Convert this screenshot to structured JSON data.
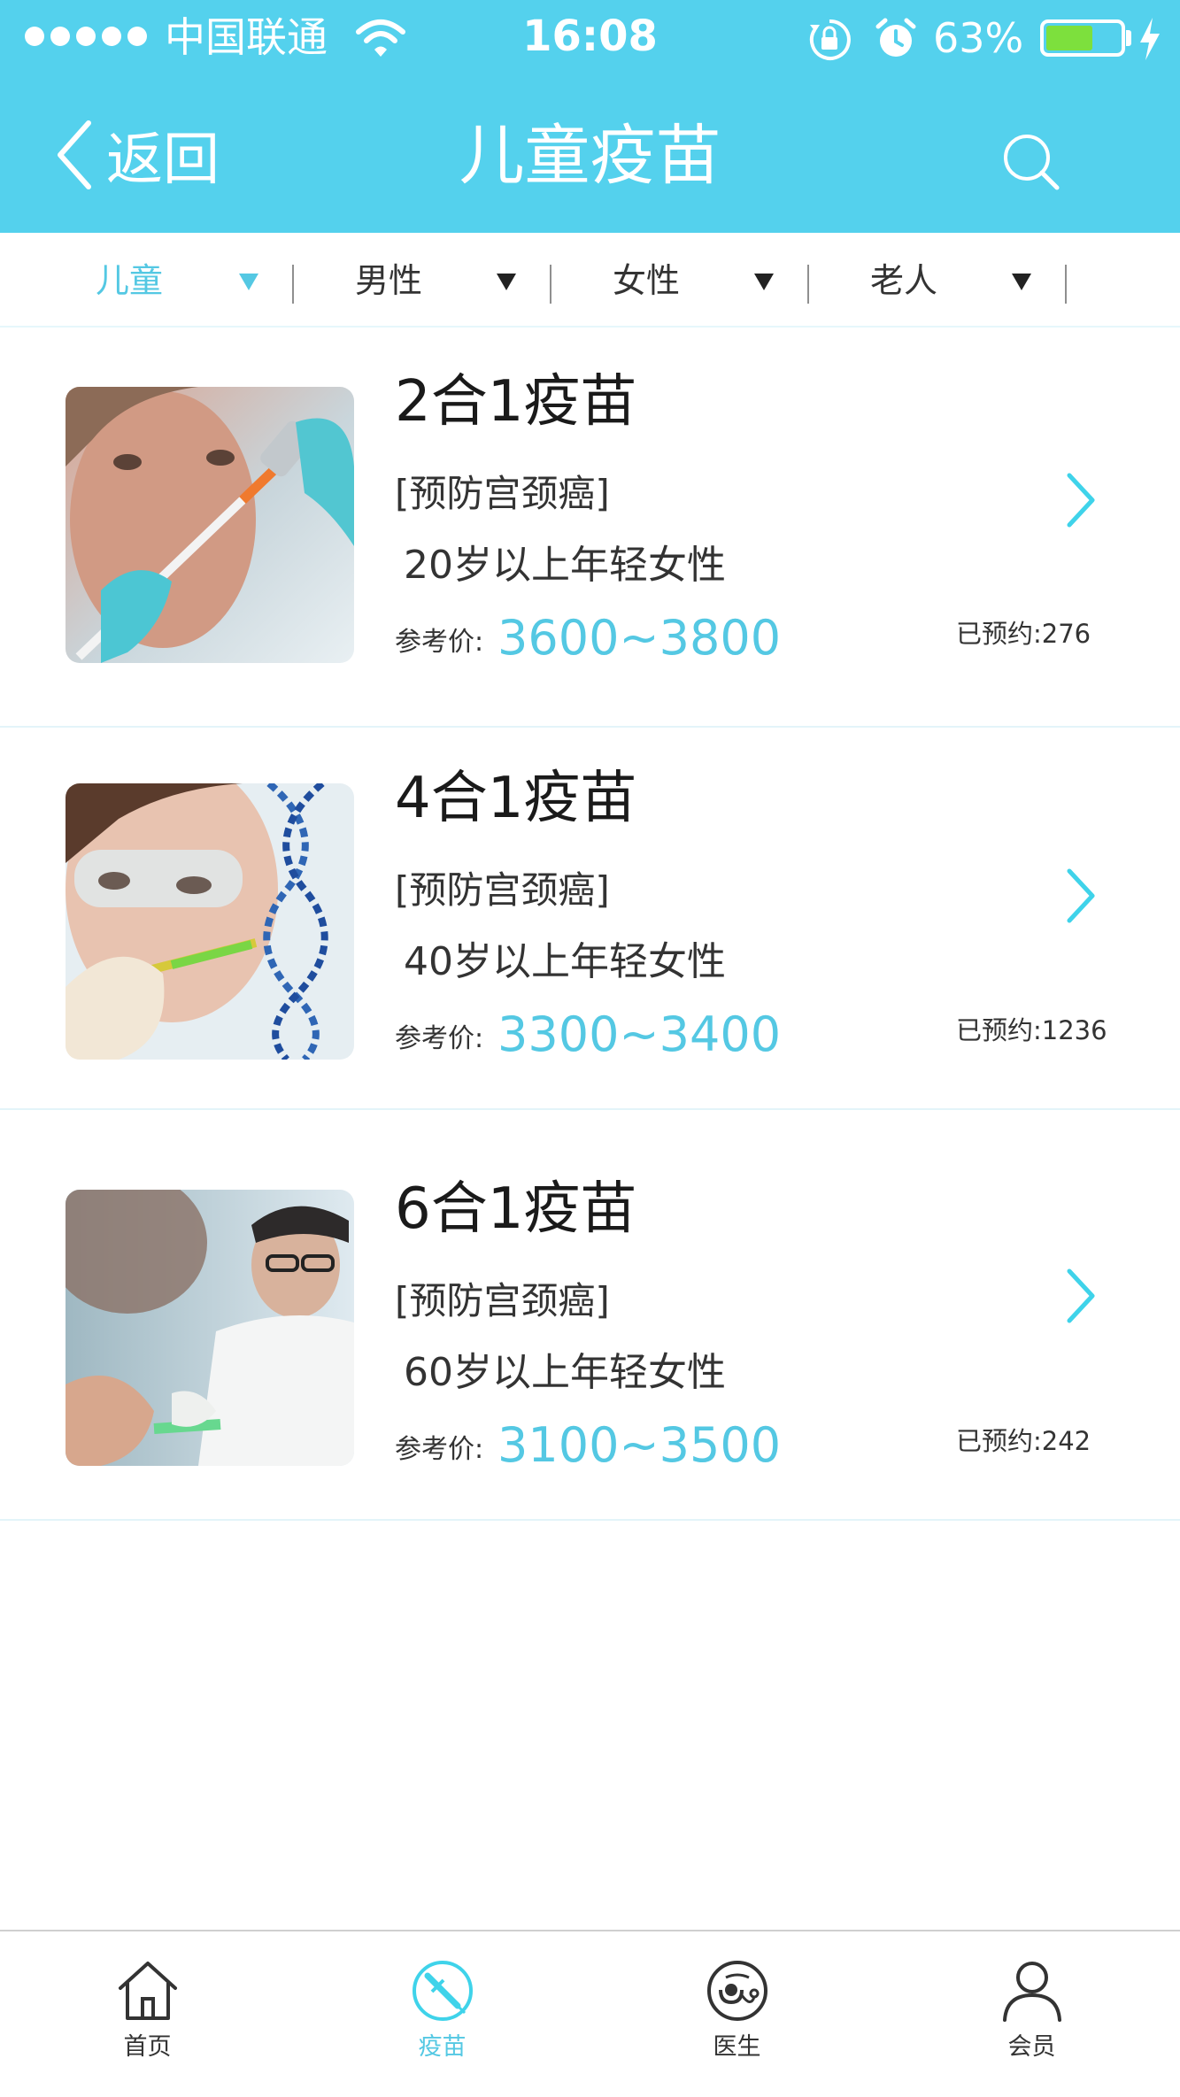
{
  "status_bar": {
    "carrier": "中国联通",
    "time": "16:08",
    "battery_percent": "63%",
    "battery_level": 0.63,
    "icons": [
      "signal-dots-icon",
      "wifi-icon",
      "rotation-lock-icon",
      "alarm-icon",
      "battery-icon",
      "charging-icon"
    ]
  },
  "header": {
    "back_label": "返回",
    "title": "儿童疫苗",
    "search_icon": "search-icon"
  },
  "filters": [
    {
      "label": "儿童",
      "active": true
    },
    {
      "label": "男性",
      "active": false
    },
    {
      "label": "女性",
      "active": false
    },
    {
      "label": "老人",
      "active": false
    }
  ],
  "vaccines": [
    {
      "title": "2合1疫苗",
      "subtitle": "[预防宫颈癌]",
      "age": "20岁以上年轻女性",
      "price_label": "参考价:",
      "price": "3600~3800",
      "booked": "已预约:276"
    },
    {
      "title": "4合1疫苗",
      "subtitle": "[预防宫颈癌]",
      "age": "40岁以上年轻女性",
      "price_label": "参考价:",
      "price": "3300~3400",
      "booked": "已预约:1236"
    },
    {
      "title": "6合1疫苗",
      "subtitle": "[预防宫颈癌]",
      "age": "60岁以上年轻女性",
      "price_label": "参考价:",
      "price": "3100~3500",
      "booked": "已预约:242"
    }
  ],
  "bottom_nav": [
    {
      "label": "首页",
      "icon": "home-icon",
      "active": false
    },
    {
      "label": "疫苗",
      "icon": "syringe-icon",
      "active": true
    },
    {
      "label": "医生",
      "icon": "stethoscope-icon",
      "active": false
    },
    {
      "label": "会员",
      "icon": "user-icon",
      "active": false
    }
  ],
  "colors": {
    "brand": "#54d1ed",
    "accent": "#54c8e3",
    "battery_fill": "#7de03d"
  }
}
